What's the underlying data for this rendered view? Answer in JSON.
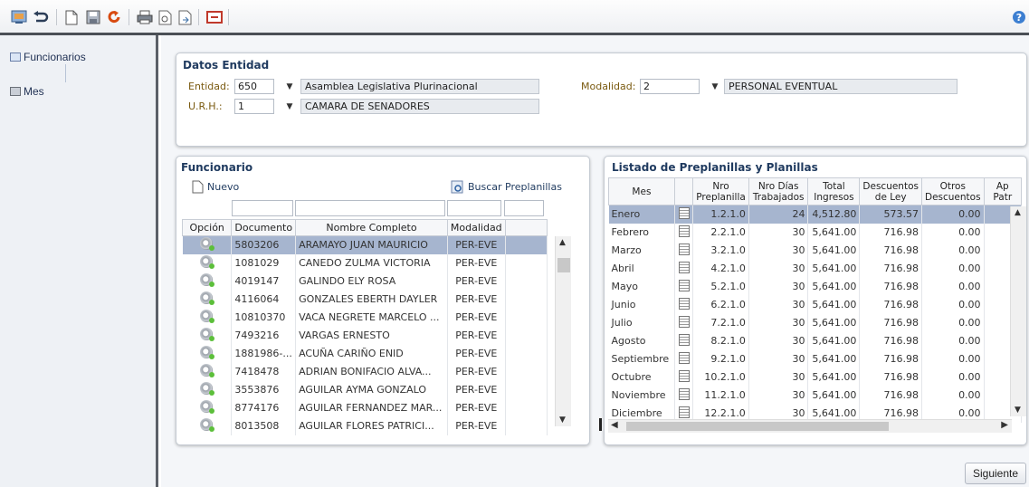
{
  "sidebar": {
    "items": [
      {
        "label": "Funcionarios"
      },
      {
        "label": "Mes"
      }
    ]
  },
  "entity": {
    "title": "Datos Entidad",
    "entidad_label": "Entidad:",
    "entidad_value": "650",
    "entidad_name": "Asamblea Legislativa Plurinacional",
    "urh_label": "U.R.H.:",
    "urh_value": "1",
    "urh_name": "CAMARA DE SENADORES",
    "modalidad_label": "Modalidad:",
    "modalidad_value": "2",
    "modalidad_name": "PERSONAL EVENTUAL"
  },
  "funcionario": {
    "title": "Funcionario",
    "new_label": "Nuevo",
    "search_label": "Buscar Preplanillas",
    "columns": [
      "Opción",
      "Documento",
      "Nombre Completo",
      "Modalidad"
    ],
    "rows": [
      {
        "doc": "5803206",
        "name": "ARAMAYO JUAN MAURICIO",
        "mod": "PER-EVE"
      },
      {
        "doc": "1081029",
        "name": "CANEDO ZULMA VICTORIA",
        "mod": "PER-EVE"
      },
      {
        "doc": "4019147",
        "name": "GALINDO ELY ROSA",
        "mod": "PER-EVE"
      },
      {
        "doc": "4116064",
        "name": "GONZALES EBERTH DAYLER",
        "mod": "PER-EVE"
      },
      {
        "doc": "10810370",
        "name": "VACA NEGRETE MARCELO ...",
        "mod": "PER-EVE"
      },
      {
        "doc": "7493216",
        "name": "VARGAS ERNESTO",
        "mod": "PER-EVE"
      },
      {
        "doc": "1881986-...",
        "name": "ACUÑA CARIÑO ENID",
        "mod": "PER-EVE"
      },
      {
        "doc": "7418478",
        "name": "ADRIAN BONIFACIO ALVA...",
        "mod": "PER-EVE"
      },
      {
        "doc": "3553876",
        "name": "AGUILAR AYMA GONZALO",
        "mod": "PER-EVE"
      },
      {
        "doc": "8774176",
        "name": "AGUILAR FERNANDEZ MAR...",
        "mod": "PER-EVE"
      },
      {
        "doc": "8013508",
        "name": "AGUILAR FLORES PATRICI...",
        "mod": "PER-EVE"
      }
    ]
  },
  "listado": {
    "title": "Listado de Preplanillas y Planillas",
    "columns": [
      "Mes",
      "",
      "Nro Preplanilla",
      "Nro Días Trabajados",
      "Total Ingresos",
      "Descuentos de Ley",
      "Otros Descuentos",
      "Ap Patr"
    ],
    "rows": [
      {
        "mes": "Enero",
        "nro": "1.2.1.0",
        "dias": "24",
        "total": "4,512.80",
        "desc": "573.57",
        "otros": "0.00"
      },
      {
        "mes": "Febrero",
        "nro": "2.2.1.0",
        "dias": "30",
        "total": "5,641.00",
        "desc": "716.98",
        "otros": "0.00"
      },
      {
        "mes": "Marzo",
        "nro": "3.2.1.0",
        "dias": "30",
        "total": "5,641.00",
        "desc": "716.98",
        "otros": "0.00"
      },
      {
        "mes": "Abril",
        "nro": "4.2.1.0",
        "dias": "30",
        "total": "5,641.00",
        "desc": "716.98",
        "otros": "0.00"
      },
      {
        "mes": "Mayo",
        "nro": "5.2.1.0",
        "dias": "30",
        "total": "5,641.00",
        "desc": "716.98",
        "otros": "0.00"
      },
      {
        "mes": "Junio",
        "nro": "6.2.1.0",
        "dias": "30",
        "total": "5,641.00",
        "desc": "716.98",
        "otros": "0.00"
      },
      {
        "mes": "Julio",
        "nro": "7.2.1.0",
        "dias": "30",
        "total": "5,641.00",
        "desc": "716.98",
        "otros": "0.00"
      },
      {
        "mes": "Agosto",
        "nro": "8.2.1.0",
        "dias": "30",
        "total": "5,641.00",
        "desc": "716.98",
        "otros": "0.00"
      },
      {
        "mes": "Septiembre",
        "nro": "9.2.1.0",
        "dias": "30",
        "total": "5,641.00",
        "desc": "716.98",
        "otros": "0.00"
      },
      {
        "mes": "Octubre",
        "nro": "10.2.1.0",
        "dias": "30",
        "total": "5,641.00",
        "desc": "716.98",
        "otros": "0.00"
      },
      {
        "mes": "Noviembre",
        "nro": "11.2.1.0",
        "dias": "30",
        "total": "5,641.00",
        "desc": "716.98",
        "otros": "0.00"
      },
      {
        "mes": "Diciembre",
        "nro": "12.2.1.0",
        "dias": "30",
        "total": "5,641.00",
        "desc": "716.98",
        "otros": "0.00"
      }
    ]
  },
  "footer": {
    "next_label": "Siguiente"
  },
  "toolbar": {
    "icons": [
      "monitor-icon",
      "undo-icon",
      "new-doc-icon",
      "save-icon",
      "refresh-icon",
      "print-icon",
      "preview-icon",
      "export-icon",
      "close-window-icon",
      "help-icon"
    ]
  },
  "colors": {
    "accent": "#1f3a5f",
    "selection": "#a6b5cf",
    "sidebar": "#eef1f5"
  }
}
